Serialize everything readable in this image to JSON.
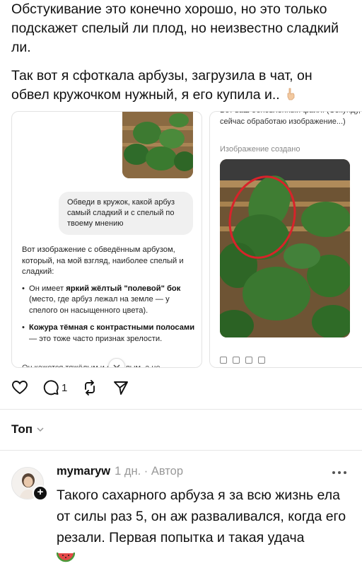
{
  "post": {
    "paragraph1": "Обстукивание это конечно хорошо, но это только подскажет спелый ли плод, но неизвестно сладкий ли.",
    "paragraph2": "Так вот я сфоткала арбузы, загрузила в чат, он обвел кружочком нужный, я его купила и..",
    "paragraph2_emoji": "pointing-down-hand-icon"
  },
  "screenshot1": {
    "user_prompt": "Обведи в кружок, какой арбуз самый сладкий и с спелый по твоему мнению",
    "ai_intro": "Вот изображение с обведённым арбузом, который, на мой взгляд, наиболее спелый и сладкий:",
    "bullet1_pre": "Он имеет ",
    "bullet1_bold": "яркий жёлтый \"полевой\" бок",
    "bullet1_post": " (место, где арбуз лежал на земле — у спелого он насыщенного цвета).",
    "bullet2_bold": "Кожура тёмная с контрастными полосами",
    "bullet2_post": " — это тоже часто признак зрелости.",
    "cut_line": "Он кажется тяжёлым и округлым, а не"
  },
  "screenshot2": {
    "top_cut": "Вот ваш обновлённый файл: (Секунду, сейчас обработаю изображение...)",
    "created_label": "Изображение создано"
  },
  "actions": {
    "like_icon": "heart-icon",
    "comment_icon": "comment-icon",
    "comment_count": "1",
    "repost_icon": "repost-icon",
    "share_icon": "send-icon"
  },
  "comments_sort": {
    "label": "Топ"
  },
  "comment": {
    "username": "mymaryw",
    "meta": "1 дн. · Автор",
    "text": "Такого сахарного арбуза я за всю жизнь ела от силы раз 5, он аж разваливался, когда его резали. Первая попытка и такая удача",
    "emoji": "watermelon-slice-icon"
  },
  "colors": {
    "text": "#111111",
    "muted": "#999999",
    "circle_red": "#d8232a",
    "watermelon_green": "#2f6b2a",
    "crate_wood": "#8a6a42"
  }
}
